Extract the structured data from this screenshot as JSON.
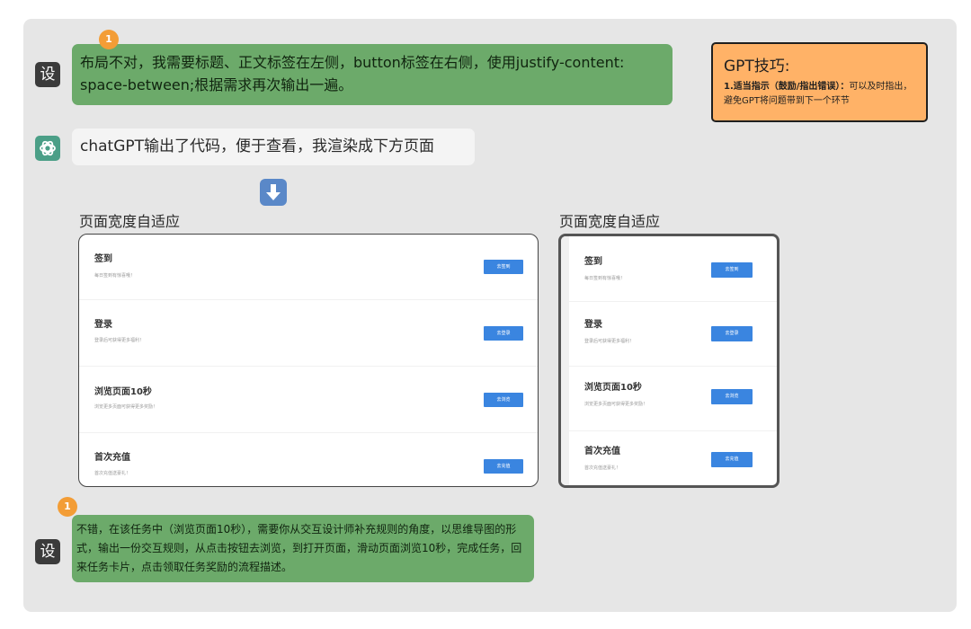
{
  "msg1": {
    "avatar": "设",
    "badge": "1",
    "text": "布局不对，我需要标题、正文标签在左侧，button标签在右侧，使用justify-content: space-between;根据需求再次输出一遍。"
  },
  "tip": {
    "title": "GPT技巧:",
    "bold": "1.适当指示（鼓励/指出错误）：",
    "body": "可以及时指出，避免GPT将问题带到下一个环节"
  },
  "msg2": {
    "text": "chatGPT输出了代码，便于查看，我渲染成下方页面"
  },
  "preview": {
    "caption_left": "页面宽度自适应",
    "caption_right": "页面宽度自适应",
    "tasks": [
      {
        "title": "签到",
        "desc": "每日签到有惊喜哦！",
        "button": "去签到"
      },
      {
        "title": "登录",
        "desc": "登录后可获得更多福利！",
        "button": "去登录"
      },
      {
        "title": "浏览页面10秒",
        "desc": "浏览更多页面可获得更多奖励！",
        "button": "去浏览"
      },
      {
        "title": "首次充值",
        "desc": "首次充值送豪礼！",
        "button": "去充值"
      }
    ]
  },
  "msg3": {
    "avatar": "设",
    "badge": "1",
    "text": "不错，在该任务中（浏览页面10秒），需要你从交互设计师补充规则的角度，以思维导图的形式，输出一份交互规则，从点击按钮去浏览，到打开页面，滑动页面浏览10秒，完成任务，回来任务卡片，点击领取任务奖励的流程描述。"
  },
  "colors": {
    "green": "#6caa6a",
    "orange": "#ffb267",
    "blue": "#3a85e0"
  },
  "icons": {
    "gpt": "openai-logo-icon",
    "arrow": "down-arrow-icon"
  }
}
